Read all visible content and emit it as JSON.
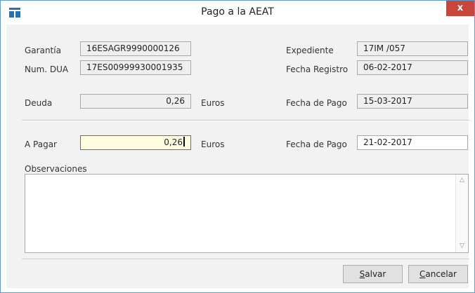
{
  "window": {
    "title": "Pago a la AEAT",
    "close_label": "x"
  },
  "form": {
    "garantia": {
      "label": "Garantía",
      "value": "16ESAGR9990000126"
    },
    "num_dua": {
      "label": "Num. DUA",
      "value": "17ES00999930001935"
    },
    "expediente": {
      "label": "Expediente",
      "value": "17IM /057"
    },
    "fecha_registro": {
      "label": "Fecha Registro",
      "value": "06-02-2017"
    },
    "deuda": {
      "label": "Deuda",
      "value": "0,26",
      "unit": "Euros"
    },
    "fecha_pago_deuda": {
      "label": "Fecha de Pago",
      "value": "15-03-2017"
    },
    "a_pagar": {
      "label": "A Pagar",
      "value": "0,26",
      "unit": "Euros"
    },
    "fecha_pago": {
      "label": "Fecha de Pago",
      "value": "21-02-2017"
    },
    "observaciones": {
      "label": "Observaciones",
      "value": ""
    }
  },
  "buttons": {
    "salvar": {
      "mnemonic": "S",
      "rest": "alvar"
    },
    "cancelar": {
      "mnemonic": "C",
      "rest": "ancelar"
    }
  },
  "icons": {
    "app": "app-window-icon",
    "scroll_up": "scroll-up-icon",
    "scroll_down": "scroll-down-icon"
  },
  "colors": {
    "close_button": "#c9463d",
    "window_border": "#5a9bd5",
    "editing_field": "#fffde0",
    "app_icon": "#2a6fb0"
  }
}
